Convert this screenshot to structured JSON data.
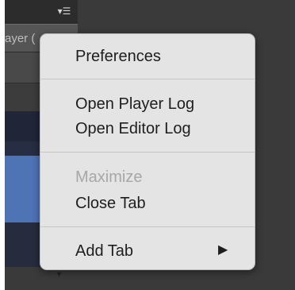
{
  "background": {
    "tab_options_icon": "menu-lines-icon",
    "player_tab_label": "ayer (",
    "scroll_arrow": "▼"
  },
  "context_menu": {
    "items": [
      {
        "label": "Preferences",
        "enabled": true
      },
      {
        "label": "Open Player Log",
        "enabled": true
      },
      {
        "label": "Open Editor Log",
        "enabled": true
      },
      {
        "label": "Maximize",
        "enabled": false
      },
      {
        "label": "Close Tab",
        "enabled": true
      },
      {
        "label": "Add Tab",
        "enabled": true,
        "submenu": true
      }
    ],
    "submenu_arrow": "▶"
  },
  "colors": {
    "menu_background": "#e4e4e4",
    "menu_text": "#1e1e1e",
    "disabled_text": "#a7a7a7",
    "selection_blue": "#4f74b6"
  }
}
